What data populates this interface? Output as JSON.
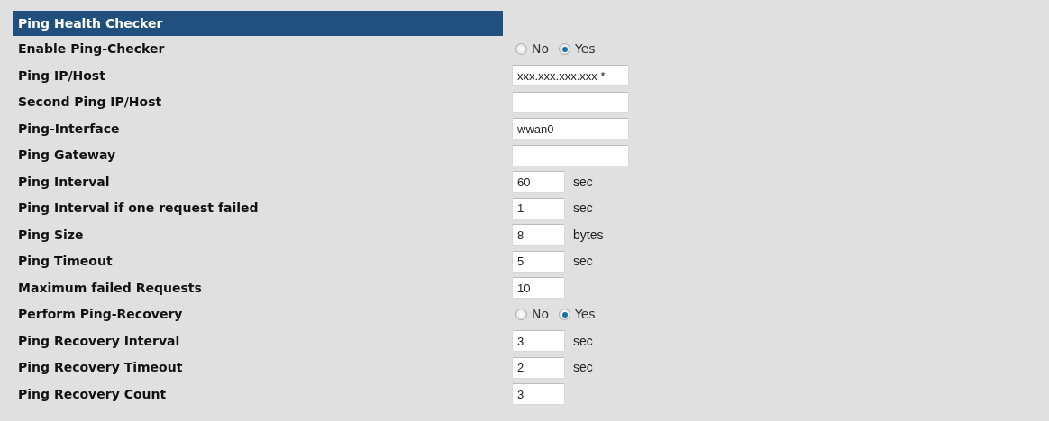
{
  "section": {
    "title": "Ping Health Checker"
  },
  "rows": [
    {
      "label": "Enable Ping-Checker",
      "kind": "radio",
      "options": [
        {
          "label": "No",
          "selected": false
        },
        {
          "label": "Yes",
          "selected": true
        }
      ]
    },
    {
      "label": "Ping IP/Host",
      "kind": "wide",
      "value": "xxx.xxx.xxx.xxx *"
    },
    {
      "label": "Second Ping IP/Host",
      "kind": "wide"
    },
    {
      "label": "Ping-Interface",
      "kind": "wide",
      "value": "wwan0"
    },
    {
      "label": "Ping Gateway",
      "kind": "wide"
    },
    {
      "label": "Ping Interval",
      "kind": "short",
      "value": "60",
      "unit": "sec"
    },
    {
      "label": "Ping Interval if one request failed",
      "kind": "short",
      "value": "1",
      "unit": "sec"
    },
    {
      "label": "Ping Size",
      "kind": "short",
      "value": "8",
      "unit": "bytes"
    },
    {
      "label": "Ping Timeout",
      "kind": "short",
      "value": "5",
      "unit": "sec"
    },
    {
      "label": "Maximum failed Requests",
      "kind": "short",
      "value": "10"
    },
    {
      "label": "Perform Ping-Recovery",
      "kind": "radio",
      "options": [
        {
          "label": "No",
          "selected": false
        },
        {
          "label": "Yes",
          "selected": true
        }
      ]
    },
    {
      "label": "Ping Recovery Interval",
      "kind": "short",
      "value": "3",
      "unit": "sec"
    },
    {
      "label": "Ping Recovery Timeout",
      "kind": "short",
      "value": "2",
      "unit": "sec"
    },
    {
      "label": "Ping Recovery Count",
      "kind": "short",
      "value": "3"
    }
  ]
}
